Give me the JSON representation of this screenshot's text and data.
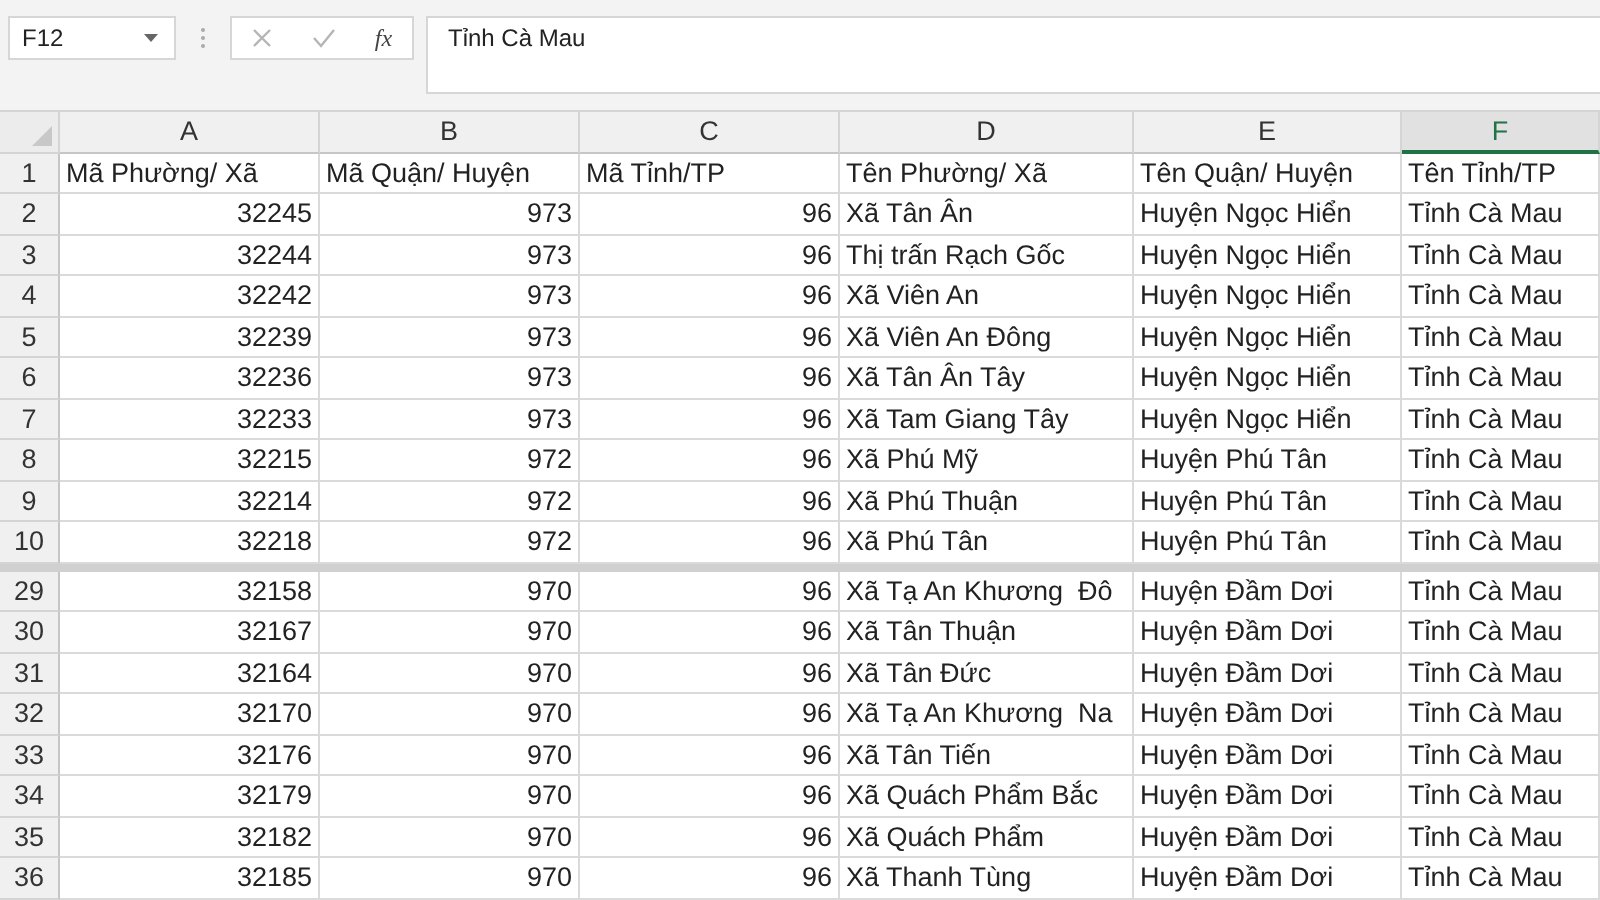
{
  "formula_bar": {
    "name_box": "F12",
    "function_label": "fx",
    "formula": "Tỉnh Cà Mau"
  },
  "columns": [
    {
      "letter": "A",
      "kind": "number",
      "selected": false
    },
    {
      "letter": "B",
      "kind": "number",
      "selected": false
    },
    {
      "letter": "C",
      "kind": "number",
      "selected": false
    },
    {
      "letter": "D",
      "kind": "text",
      "selected": false
    },
    {
      "letter": "E",
      "kind": "text",
      "selected": false
    },
    {
      "letter": "F",
      "kind": "text",
      "selected": true
    }
  ],
  "header_row": {
    "number": "1",
    "cells": [
      "Mã Phường/ Xã",
      "Mã Quận/ Huyện",
      "Mã Tỉnh/TP",
      "Tên Phường/ Xã",
      "Tên Quận/ Huyện",
      "Tên Tỉnh/TP"
    ]
  },
  "top_rows": [
    {
      "number": "2",
      "cells": [
        "32245",
        "973",
        "96",
        "Xã Tân Ân",
        "Huyện Ngọc Hiển",
        "Tỉnh Cà Mau"
      ]
    },
    {
      "number": "3",
      "cells": [
        "32244",
        "973",
        "96",
        "Thị trấn Rạch Gốc",
        "Huyện Ngọc Hiển",
        "Tỉnh Cà Mau"
      ]
    },
    {
      "number": "4",
      "cells": [
        "32242",
        "973",
        "96",
        "Xã Viên An",
        "Huyện Ngọc Hiển",
        "Tỉnh Cà Mau"
      ]
    },
    {
      "number": "5",
      "cells": [
        "32239",
        "973",
        "96",
        "Xã Viên An Đông",
        "Huyện Ngọc Hiển",
        "Tỉnh Cà Mau"
      ]
    },
    {
      "number": "6",
      "cells": [
        "32236",
        "973",
        "96",
        "Xã Tân Ân Tây",
        "Huyện Ngọc Hiển",
        "Tỉnh Cà Mau"
      ]
    },
    {
      "number": "7",
      "cells": [
        "32233",
        "973",
        "96",
        "Xã Tam Giang Tây",
        "Huyện Ngọc Hiển",
        "Tỉnh Cà Mau"
      ]
    },
    {
      "number": "8",
      "cells": [
        "32215",
        "972",
        "96",
        "Xã Phú Mỹ",
        "Huyện Phú Tân",
        "Tỉnh Cà Mau"
      ]
    },
    {
      "number": "9",
      "cells": [
        "32214",
        "972",
        "96",
        "Xã Phú Thuận",
        "Huyện Phú Tân",
        "Tỉnh Cà Mau"
      ]
    },
    {
      "number": "10",
      "cells": [
        "32218",
        "972",
        "96",
        "Xã Phú Tân",
        "Huyện Phú Tân",
        "Tỉnh Cà Mau"
      ]
    }
  ],
  "bottom_rows": [
    {
      "number": "29",
      "cells": [
        "32158",
        "970",
        "96",
        "Xã Tạ An Khương  Đô",
        "Huyện Đầm Dơi",
        "Tỉnh Cà Mau"
      ]
    },
    {
      "number": "30",
      "cells": [
        "32167",
        "970",
        "96",
        "Xã Tân Thuận",
        "Huyện Đầm Dơi",
        "Tỉnh Cà Mau"
      ]
    },
    {
      "number": "31",
      "cells": [
        "32164",
        "970",
        "96",
        "Xã Tân Đức",
        "Huyện Đầm Dơi",
        "Tỉnh Cà Mau"
      ]
    },
    {
      "number": "32",
      "cells": [
        "32170",
        "970",
        "96",
        "Xã Tạ An Khương  Na",
        "Huyện Đầm Dơi",
        "Tỉnh Cà Mau"
      ]
    },
    {
      "number": "33",
      "cells": [
        "32176",
        "970",
        "96",
        "Xã Tân Tiến",
        "Huyện Đầm Dơi",
        "Tỉnh Cà Mau"
      ]
    },
    {
      "number": "34",
      "cells": [
        "32179",
        "970",
        "96",
        "Xã Quách Phẩm Bắc",
        "Huyện Đầm Dơi",
        "Tỉnh Cà Mau"
      ]
    },
    {
      "number": "35",
      "cells": [
        "32182",
        "970",
        "96",
        "Xã Quách Phẩm",
        "Huyện Đầm Dơi",
        "Tỉnh Cà Mau"
      ]
    },
    {
      "number": "36",
      "cells": [
        "32185",
        "970",
        "96",
        "Xã Thanh Tùng",
        "Huyện Đầm Dơi",
        "Tỉnh Cà Mau"
      ]
    }
  ]
}
